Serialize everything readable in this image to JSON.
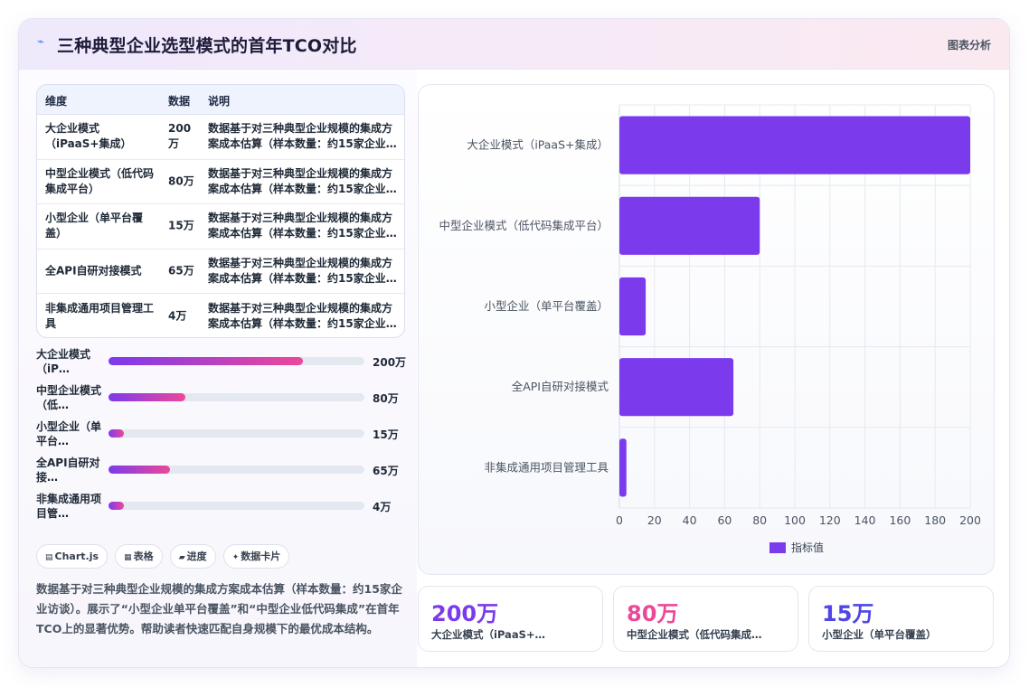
{
  "header": {
    "title": "三种典型企业选型模式的首年TCO对比",
    "tag": "图表分析"
  },
  "table": {
    "columns": [
      "维度",
      "数据",
      "说明"
    ],
    "rows": [
      {
        "dim": "大企业模式（iPaaS+集成）",
        "value": "200万",
        "note": "数据基于对三种典型企业规模的集成方案成本估算（样本数量：约15家企业…"
      },
      {
        "dim": "中型企业模式（低代码集成平台）",
        "value": "80万",
        "note": "数据基于对三种典型企业规模的集成方案成本估算（样本数量：约15家企业…"
      },
      {
        "dim": "小型企业（单平台覆盖）",
        "value": "15万",
        "note": "数据基于对三种典型企业规模的集成方案成本估算（样本数量：约15家企业…"
      },
      {
        "dim": "全API自研对接模式",
        "value": "65万",
        "note": "数据基于对三种典型企业规模的集成方案成本估算（样本数量：约15家企业…"
      },
      {
        "dim": "非集成通用项目管理工具",
        "value": "4万",
        "note": "数据基于对三种典型企业规模的集成方案成本估算（样本数量：约15家企业…"
      }
    ]
  },
  "progress": [
    {
      "label": "大企业模式（iP…",
      "value": "200万",
      "fraction": 0.76
    },
    {
      "label": "中型企业模式（低…",
      "value": "80万",
      "fraction": 0.3
    },
    {
      "label": "小型企业（单平台…",
      "value": "15万",
      "fraction": 0.06
    },
    {
      "label": "全API自研对接…",
      "value": "65万",
      "fraction": 0.24
    },
    {
      "label": "非集成通用项目管…",
      "value": "4万",
      "fraction": 0.06
    }
  ],
  "chips": [
    {
      "icon": "chart-icon",
      "label": "Chart.js"
    },
    {
      "icon": "table-icon",
      "label": "表格"
    },
    {
      "icon": "progress-icon",
      "label": "进度"
    },
    {
      "icon": "card-icon",
      "label": "数据卡片"
    }
  ],
  "description": "数据基于对三种典型企业规模的集成方案成本估算（样本数量：约15家企业访谈）。展示了“小型企业单平台覆盖”和“中型企业低代码集成”在首年TCO上的显著优势。帮助读者快速匹配自身规模下的最优成本结构。",
  "chart_data": {
    "type": "bar",
    "orientation": "horizontal",
    "categories": [
      "大企业模式（iPaaS+集成）",
      "中型企业模式（低代码集成平台）",
      "小型企业（单平台覆盖）",
      "全API自研对接模式",
      "非集成通用项目管理工具"
    ],
    "series": [
      {
        "name": "指标值",
        "values": [
          200,
          80,
          15,
          65,
          4
        ],
        "color": "#7c3aed"
      }
    ],
    "xlim": [
      0,
      200
    ],
    "xticks": [
      0,
      20,
      40,
      60,
      80,
      100,
      120,
      140,
      160,
      180,
      200
    ],
    "grid": true,
    "legend": "bottom"
  },
  "stats": [
    {
      "value": "200万",
      "label": "大企业模式（iPaaS+…",
      "color": "#7c3aed"
    },
    {
      "value": "80万",
      "label": "中型企业模式（低代码集成…",
      "color": "#ec4899"
    },
    {
      "value": "15万",
      "label": "小型企业（单平台覆盖）",
      "color": "#4f46e5"
    }
  ],
  "colors": {
    "accent": "#7c3aed",
    "accent2": "#ec4899",
    "track": "#e3e8f1"
  }
}
